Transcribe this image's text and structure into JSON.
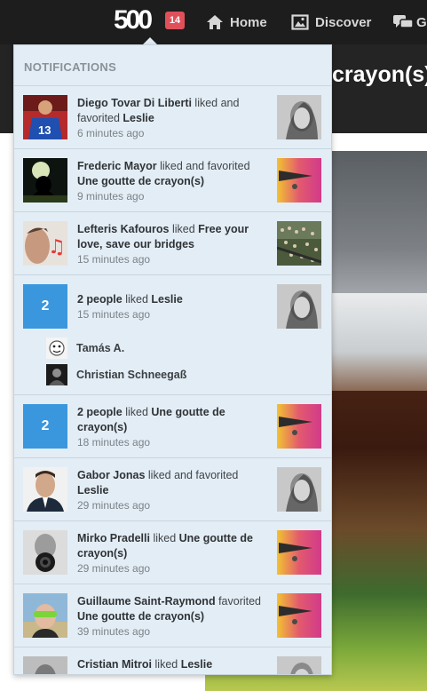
{
  "nav": {
    "logo": "500",
    "badge_count": "14",
    "home_label": "Home",
    "discover_label": "Discover",
    "chat_label": "G"
  },
  "page": {
    "title": "crayon(s)"
  },
  "notifications": {
    "header": "NOTIFICATIONS",
    "items": [
      {
        "actor": "Diego Tovar Di Liberti",
        "action": " liked and favorited ",
        "target": "Leslie",
        "time": "6 minutes ago"
      },
      {
        "actor": "Frederic Mayor",
        "action": " liked and favorited ",
        "target": "Une goutte de crayon(s)",
        "time": "9 minutes ago"
      },
      {
        "actor": "Lefteris Kafouros",
        "action": " liked ",
        "target": "Free your love, save our bridges",
        "time": "15 minutes ago"
      },
      {
        "count": "2",
        "actor": "2 people",
        "action": " liked ",
        "target": "Leslie",
        "time": "15 minutes ago",
        "people": [
          "Tamás A.",
          "Christian Schneegaß"
        ]
      },
      {
        "count": "2",
        "actor": "2 people",
        "action": " liked ",
        "target": "Une goutte de crayon(s)",
        "time": "18 minutes ago"
      },
      {
        "actor": "Gabor Jonas",
        "action": " liked and favorited ",
        "target": "Leslie",
        "time": "29 minutes ago"
      },
      {
        "actor": "Mirko Pradelli",
        "action": " liked ",
        "target": "Une goutte de crayon(s)",
        "time": "29 minutes ago"
      },
      {
        "actor": "Guillaume Saint-Raymond",
        "action": " favorited ",
        "target": "Une goutte de crayon(s)",
        "time": "39 minutes ago"
      },
      {
        "actor": "Cristian Mitroi",
        "action": " liked ",
        "target": "Leslie",
        "time": ""
      }
    ]
  },
  "icons": {
    "home": "home-icon",
    "discover": "image-icon",
    "chat": "chat-icon"
  },
  "colors": {
    "topbar": "#1d1d1d",
    "dropdown_bg": "#e3edf5",
    "badge": "#e0505a",
    "count_box": "#3a97de"
  }
}
